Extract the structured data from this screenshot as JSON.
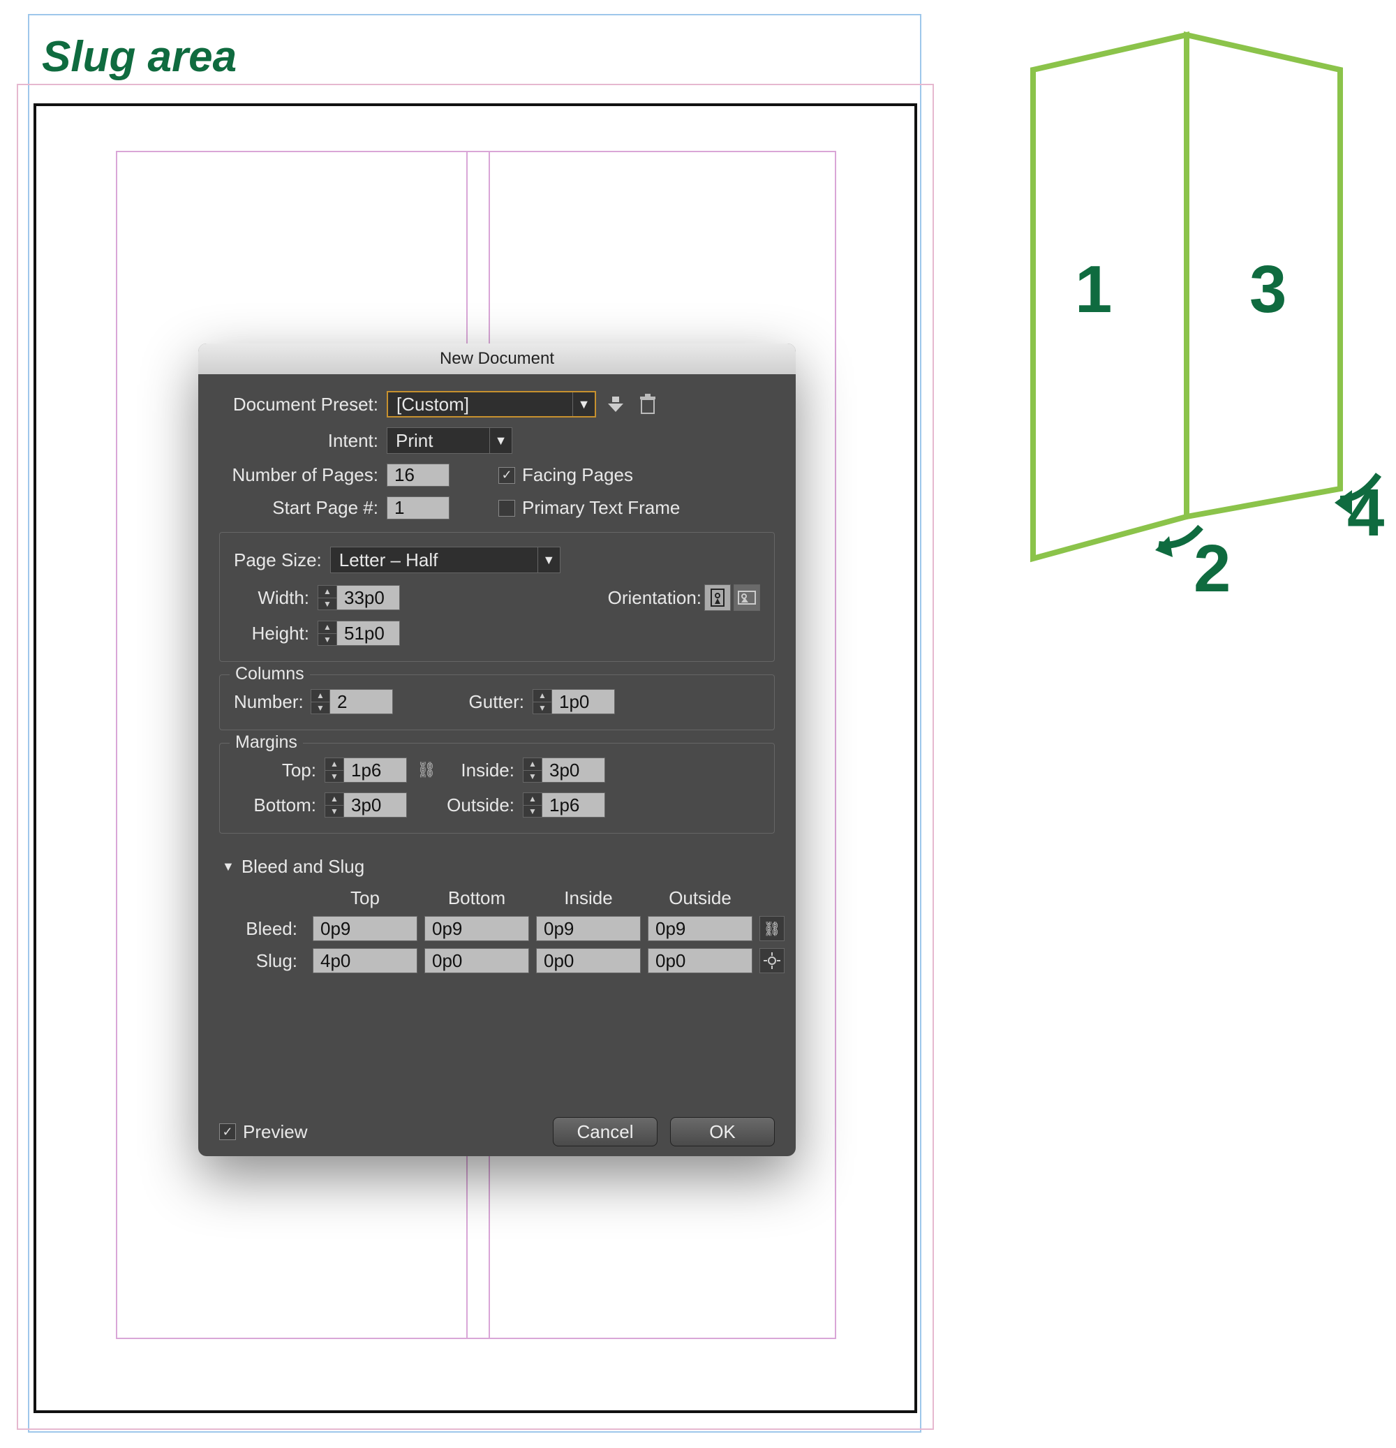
{
  "slug_label": "Slug area",
  "dialog": {
    "title": "New Document",
    "preset_label": "Document Preset:",
    "preset_value": "[Custom]",
    "intent_label": "Intent:",
    "intent_value": "Print",
    "pages_label": "Number of Pages:",
    "pages_value": "16",
    "facing_label": "Facing Pages",
    "start_label": "Start Page #:",
    "start_value": "1",
    "ptf_label": "Primary Text Frame",
    "pagesize": {
      "title": "Page Size:",
      "value": "Letter – Half",
      "width_label": "Width:",
      "width_value": "33p0",
      "height_label": "Height:",
      "height_value": "51p0",
      "orientation_label": "Orientation:"
    },
    "columns": {
      "title": "Columns",
      "number_label": "Number:",
      "number_value": "2",
      "gutter_label": "Gutter:",
      "gutter_value": "1p0"
    },
    "margins": {
      "title": "Margins",
      "top_label": "Top:",
      "top_value": "1p6",
      "bottom_label": "Bottom:",
      "bottom_value": "3p0",
      "inside_label": "Inside:",
      "inside_value": "3p0",
      "outside_label": "Outside:",
      "outside_value": "1p6"
    },
    "bleed_slug": {
      "title": "Bleed and Slug",
      "col_top": "Top",
      "col_bottom": "Bottom",
      "col_inside": "Inside",
      "col_outside": "Outside",
      "bleed_label": "Bleed:",
      "bleed": {
        "top": "0p9",
        "bottom": "0p9",
        "inside": "0p9",
        "outside": "0p9"
      },
      "slug_label": "Slug:",
      "slug": {
        "top": "4p0",
        "bottom": "0p0",
        "inside": "0p0",
        "outside": "0p0"
      }
    },
    "preview_label": "Preview",
    "cancel_label": "Cancel",
    "ok_label": "OK"
  },
  "fold": {
    "n1": "1",
    "n2": "2",
    "n3": "3",
    "n4": "4"
  }
}
